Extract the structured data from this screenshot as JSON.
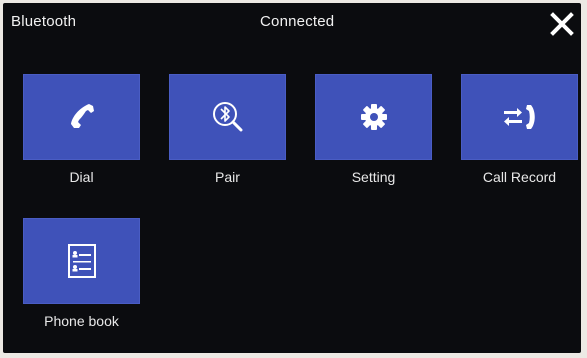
{
  "header": {
    "title": "Bluetooth",
    "status": "Connected",
    "close_icon": "close-icon"
  },
  "tiles": [
    {
      "label": "Dial",
      "icon": "phone-handset-icon"
    },
    {
      "label": "Pair",
      "icon": "bluetooth-search-icon"
    },
    {
      "label": "Setting",
      "icon": "gear-icon"
    },
    {
      "label": "Call Record",
      "icon": "call-record-icon"
    },
    {
      "label": "Phone book",
      "icon": "contacts-list-icon"
    }
  ],
  "colors": {
    "background": "#0b0c0f",
    "tile": "#3f52b9",
    "text": "#f1f1f1"
  }
}
